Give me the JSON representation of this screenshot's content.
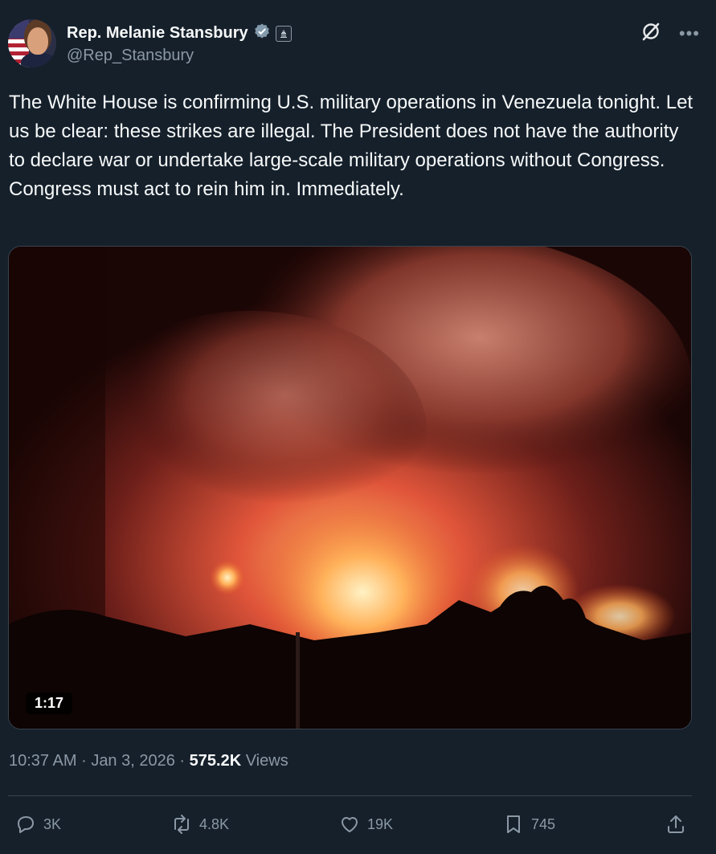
{
  "author": {
    "display_name": "Rep. Melanie Stansbury",
    "handle": "@Rep_Stansbury"
  },
  "icons": {
    "verified": "verified-badge-icon",
    "government": "government-capitol-icon",
    "grok": "grok-icon",
    "more": "more-icon",
    "reply": "reply-icon",
    "repost": "repost-icon",
    "like": "like-icon",
    "bookmark": "bookmark-icon",
    "share": "share-icon"
  },
  "tweet": {
    "text": "The White House is confirming U.S. military operations in Venezuela tonight. Let us be clear: these strikes are illegal. The President does not have the authority to declare war or undertake large-scale military operations without Congress. Congress must act to rein him in. Immediately."
  },
  "media": {
    "duration": "1:17"
  },
  "meta": {
    "time": "10:37 AM",
    "separator": "·",
    "date": "Jan 3, 2026",
    "views_count": "575.2K",
    "views_label": "Views"
  },
  "actions": {
    "reply_count": "3K",
    "repost_count": "4.8K",
    "like_count": "19K",
    "bookmark_count": "745"
  },
  "colors": {
    "background": "#15202b",
    "text_primary": "#f7f9f9",
    "text_secondary": "#8b98a5",
    "border": "#38444d"
  }
}
